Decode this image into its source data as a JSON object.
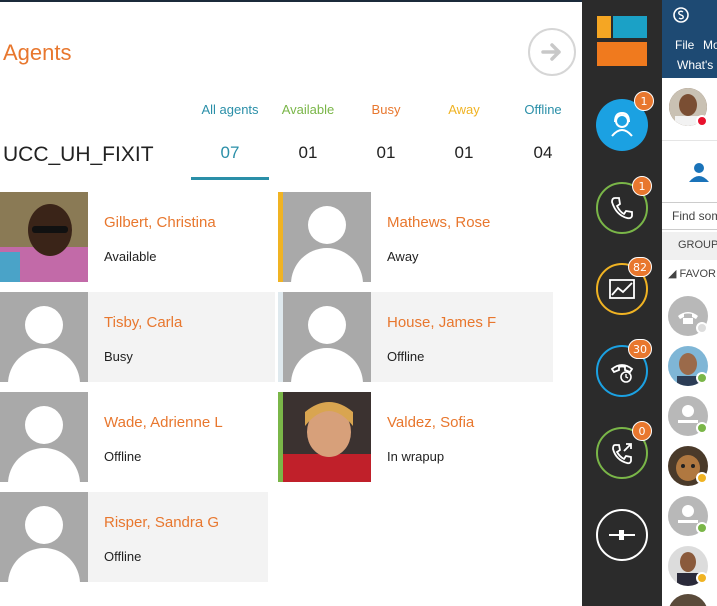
{
  "header": {
    "title": "Agents"
  },
  "queue": {
    "name": "UCC_UH_FIXIT"
  },
  "tabs": [
    {
      "label": "All agents",
      "count": "07",
      "color": "#2a8fa8"
    },
    {
      "label": "Available",
      "count": "01",
      "color": "#7ab648"
    },
    {
      "label": "Busy",
      "count": "01",
      "color": "#e8772e"
    },
    {
      "label": "Away",
      "count": "01",
      "color": "#f0b323"
    },
    {
      "label": "Offline",
      "count": "04",
      "color": "#2a8fa8"
    }
  ],
  "agents": [
    {
      "name": "Gilbert, Christina",
      "status": "Available",
      "photo": "photo"
    },
    {
      "name": "Mathews, Rose",
      "status": "Away",
      "photo": "placeholder"
    },
    {
      "name": "Tisby, Carla",
      "status": "Busy",
      "photo": "placeholder"
    },
    {
      "name": "House, James F",
      "status": "Offline",
      "photo": "placeholder"
    },
    {
      "name": "Wade, Adrienne L",
      "status": "Offline",
      "photo": "placeholder"
    },
    {
      "name": "Valdez, Sofia",
      "status": "In wrapup",
      "photo": "photo"
    },
    {
      "name": "Risper, Sandra G",
      "status": "Offline",
      "photo": "placeholder"
    }
  ],
  "rail": {
    "logo_colors": [
      "#f5a623",
      "#1ba1c6",
      "#f07a1e"
    ],
    "buttons": [
      {
        "icon": "agents-headset-icon",
        "badge": "1",
        "color": "#1ba1e2"
      },
      {
        "icon": "phone-icon",
        "badge": "1",
        "color": "#7ab648"
      },
      {
        "icon": "chart-icon",
        "badge": "82",
        "color": "#f0b323"
      },
      {
        "icon": "phone-clock-icon",
        "badge": "30",
        "color": "#1ba1e2"
      },
      {
        "icon": "phone-transfer-icon",
        "badge": "0",
        "color": "#7ab648"
      },
      {
        "icon": "slider-icon",
        "badge": "",
        "color": "#ffffff"
      }
    ]
  },
  "skype": {
    "menu_file": "File",
    "menu_more": "Mo",
    "whats_new": "What's",
    "search_placeholder": "Find som",
    "group_label": "GROUP",
    "favorites_label": "FAVOR"
  }
}
